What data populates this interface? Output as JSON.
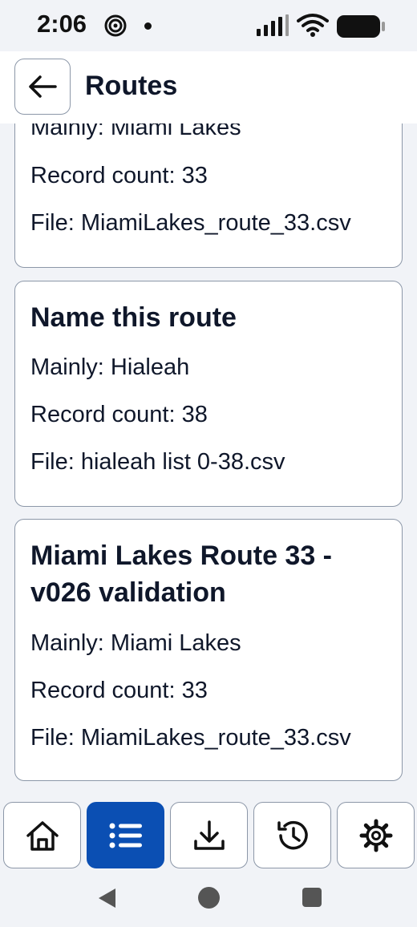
{
  "status_bar": {
    "time": "2:06"
  },
  "header": {
    "title": "Routes"
  },
  "routes": [
    {
      "name": "",
      "mainly": "Mainly: Miami Lakes",
      "record_count": "Record count: 33",
      "file": "File: MiamiLakes_route_33.csv"
    },
    {
      "name": "Name this route",
      "mainly": "Mainly: Hialeah",
      "record_count": "Record count: 38",
      "file": "File: hialeah list 0-38.csv"
    },
    {
      "name": "Miami Lakes Route 33 - v026 validation",
      "mainly": "Mainly: Miami Lakes",
      "record_count": "Record count: 33",
      "file": "File: MiamiLakes_route_33.csv"
    }
  ],
  "bottom_nav": {
    "items": [
      {
        "icon": "home-icon",
        "active": false
      },
      {
        "icon": "list-icon",
        "active": true
      },
      {
        "icon": "download-icon",
        "active": false
      },
      {
        "icon": "history-icon",
        "active": false
      },
      {
        "icon": "settings-icon",
        "active": false
      }
    ]
  },
  "colors": {
    "accent": "#0b4fb3",
    "border": "#8c97a8",
    "background": "#f1f3f7",
    "text": "#0f172a"
  }
}
